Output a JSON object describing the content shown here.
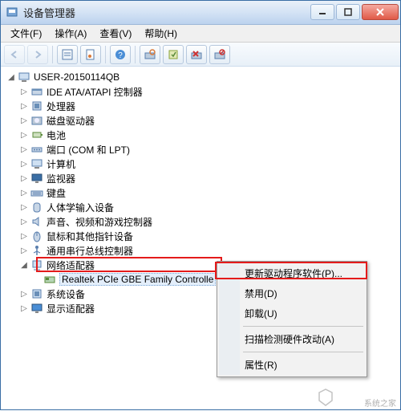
{
  "window": {
    "title": "设备管理器"
  },
  "menu": {
    "file": "文件(F)",
    "action": "操作(A)",
    "view": "查看(V)",
    "help": "帮助(H)"
  },
  "tree": {
    "root": "USER-20150114QB",
    "items": [
      {
        "label": "IDE ATA/ATAPI 控制器",
        "icon": "ide"
      },
      {
        "label": "处理器",
        "icon": "cpu"
      },
      {
        "label": "磁盘驱动器",
        "icon": "disk"
      },
      {
        "label": "电池",
        "icon": "battery"
      },
      {
        "label": "端口 (COM 和 LPT)",
        "icon": "port"
      },
      {
        "label": "计算机",
        "icon": "computer"
      },
      {
        "label": "监视器",
        "icon": "monitor"
      },
      {
        "label": "键盘",
        "icon": "keyboard"
      },
      {
        "label": "人体学输入设备",
        "icon": "hid"
      },
      {
        "label": "声音、视频和游戏控制器",
        "icon": "sound"
      },
      {
        "label": "鼠标和其他指针设备",
        "icon": "mouse"
      },
      {
        "label": "通用串行总线控制器",
        "icon": "usb"
      },
      {
        "label": "网络适配器",
        "icon": "network",
        "expanded": true,
        "children": [
          {
            "label": "Realtek PCIe GBE Family Controlle",
            "icon": "nic",
            "selected": true
          }
        ]
      },
      {
        "label": "系统设备",
        "icon": "system"
      },
      {
        "label": "显示适配器",
        "icon": "display"
      }
    ]
  },
  "context_menu": {
    "update": "更新驱动程序软件(P)...",
    "disable": "禁用(D)",
    "uninstall": "卸载(U)",
    "scan": "扫描检测硬件改动(A)",
    "properties": "属性(R)"
  },
  "watermark": "系统之家"
}
